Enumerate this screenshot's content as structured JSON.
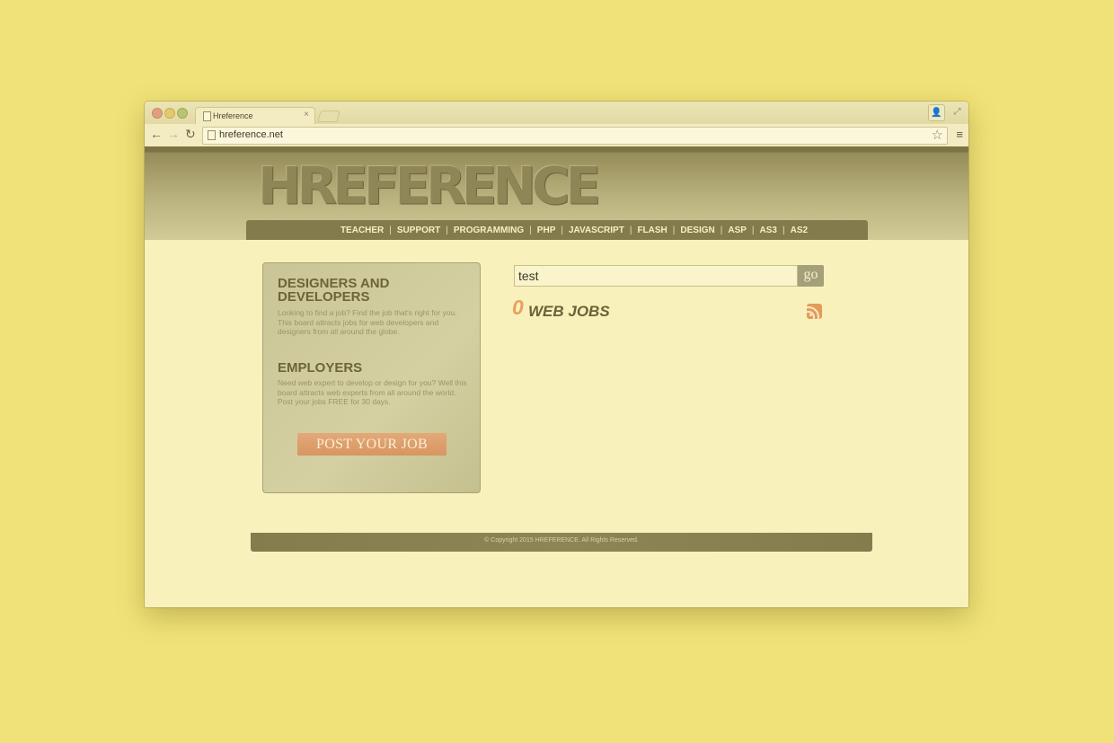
{
  "browser": {
    "tab_title": "Hreference",
    "tab_close": "×",
    "url": "hreference.net",
    "icons": [
      "back-arrow-icon",
      "forward-arrow-icon",
      "reload-icon",
      "document-icon",
      "star-icon",
      "menu-icon",
      "profile-icon",
      "fullscreen-icon"
    ],
    "back_glyph": "←",
    "forward_glyph": "→",
    "reload_glyph": "↻",
    "star_glyph": "☆",
    "menu_glyph": "≡",
    "profile_glyph": "👤",
    "expand_glyph": "⤢"
  },
  "site": {
    "logo": "HREFERENCE",
    "nav": [
      {
        "label": "TEACHER"
      },
      {
        "label": "SUPPORT"
      },
      {
        "label": "PROGRAMMING"
      },
      {
        "label": "PHP"
      },
      {
        "label": "JAVASCRIPT"
      },
      {
        "label": "FLASH"
      },
      {
        "label": "DESIGN"
      },
      {
        "label": "ASP"
      },
      {
        "label": "AS3"
      },
      {
        "label": "AS2"
      }
    ],
    "nav_separator": "|"
  },
  "sidebar": {
    "designers_heading": "DESIGNERS AND DEVELOPERS",
    "designers_text": "Looking to find a job? Find the job that's right for you. This board attracts jobs for web developers and designers from all around the globe.",
    "employers_heading": "EMPLOYERS",
    "employers_text": "Need web expert to develop or design for you? Well this board attracts web experts from all around the world. Post your jobs FREE for 30 days.",
    "post_button": "POST YOUR JOB"
  },
  "search": {
    "value": "test",
    "go_label": "go"
  },
  "results": {
    "count": "0",
    "label": "WEB JOBS"
  },
  "footer": {
    "copyright": "© Copyright 2015 HREFERENCE. All Rights Reserved."
  },
  "colors": {
    "background": "#f0e278",
    "header_dark": "#7d7446",
    "accent_orange": "#e8a260",
    "heading_olive": "#6d6538"
  }
}
